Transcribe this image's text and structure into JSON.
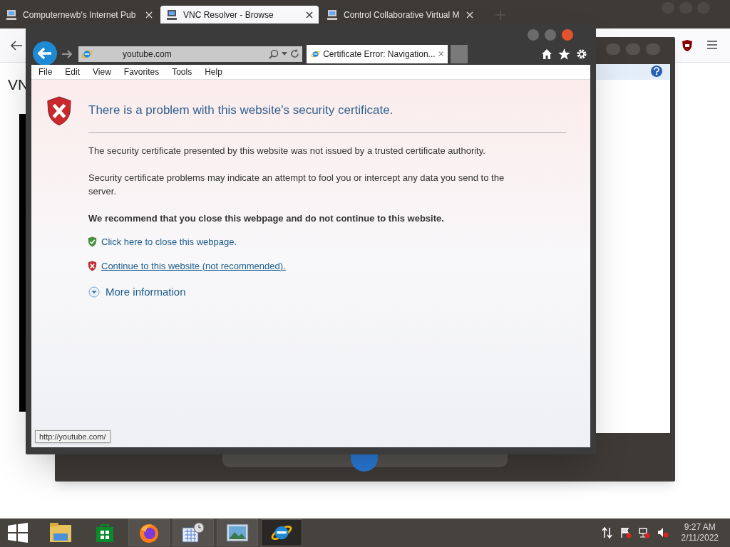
{
  "host_browser": {
    "tabs": [
      {
        "label": "Computernewb's Internet Pub",
        "selected": false
      },
      {
        "label": "VNC Resolver - Browse",
        "selected": true
      },
      {
        "label": "Control Collaborative Virtual M",
        "selected": false
      }
    ],
    "page_heading": "VN"
  },
  "ie_window": {
    "address": "youtube.com",
    "tab_label": "Certificate Error: Navigation...",
    "menu": [
      "File",
      "Edit",
      "View",
      "Favorites",
      "Tools",
      "Help"
    ],
    "page": {
      "title": "There is a problem with this website's security certificate.",
      "paragraphs": [
        "The security certificate presented by this website was not issued by a trusted certificate authority.",
        "Security certificate problems may indicate an attempt to fool you or intercept any data you send to the server."
      ],
      "recommendation": "We recommend that you close this webpage and do not continue to this website.",
      "links": [
        {
          "kind": "safe",
          "label": "Click here to close this webpage.",
          "hovered": false
        },
        {
          "kind": "unsafe",
          "label": "Continue to this website (not recommended).",
          "hovered": true
        }
      ],
      "more_info": "More information"
    },
    "status_url": "http://youtube.com/"
  },
  "taskbar": {
    "apps": [
      {
        "kind": "explorer",
        "running": false,
        "selected": false
      },
      {
        "kind": "store",
        "running": false,
        "selected": false
      },
      {
        "kind": "firefox",
        "running": true,
        "selected": false
      },
      {
        "kind": "calendar",
        "running": true,
        "selected": false
      },
      {
        "kind": "photos",
        "running": true,
        "selected": false
      },
      {
        "kind": "ie",
        "running": true,
        "selected": true
      }
    ],
    "time": "9:27 AM",
    "date": "2/11/2022"
  }
}
